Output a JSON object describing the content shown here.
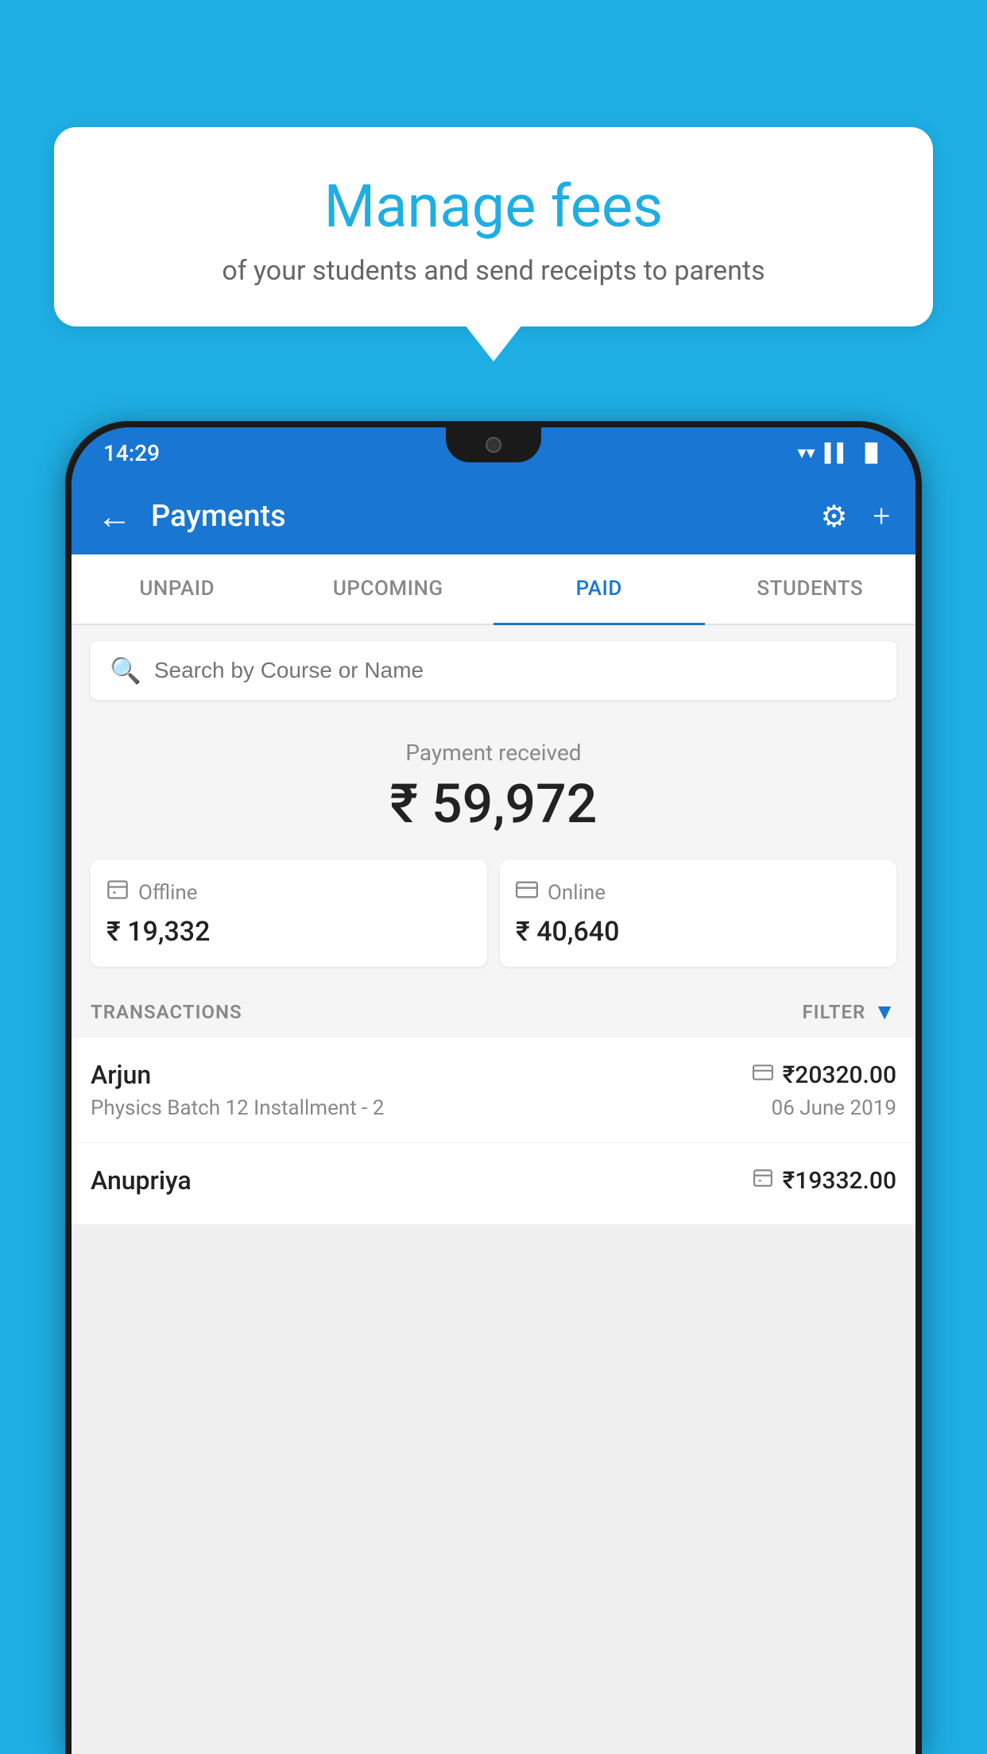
{
  "page": {
    "background_color": "#1EAEE4"
  },
  "speech_bubble": {
    "title": "Manage fees",
    "subtitle": "of your students and send receipts to parents"
  },
  "status_bar": {
    "time": "14:29",
    "wifi_icon": "▼",
    "signal_icon": "◀",
    "battery_icon": "▐"
  },
  "app_bar": {
    "back_icon": "←",
    "title": "Payments",
    "settings_icon": "⚙",
    "add_icon": "+"
  },
  "tabs": [
    {
      "id": "unpaid",
      "label": "UNPAID",
      "active": false
    },
    {
      "id": "upcoming",
      "label": "UPCOMING",
      "active": false
    },
    {
      "id": "paid",
      "label": "PAID",
      "active": true
    },
    {
      "id": "students",
      "label": "STUDENTS",
      "active": false
    }
  ],
  "search": {
    "placeholder": "Search by Course or Name"
  },
  "payment_summary": {
    "label": "Payment received",
    "amount": "₹ 59,972"
  },
  "payment_cards": [
    {
      "id": "offline",
      "icon": "💳",
      "label": "Offline",
      "amount": "₹ 19,332"
    },
    {
      "id": "online",
      "icon": "💳",
      "label": "Online",
      "amount": "₹ 40,640"
    }
  ],
  "transactions": {
    "header_label": "TRANSACTIONS",
    "filter_label": "FILTER"
  },
  "transaction_list": [
    {
      "student_name": "Arjun",
      "payment_type": "online",
      "amount": "₹20320.00",
      "course": "Physics Batch 12 Installment - 2",
      "date": "06 June 2019"
    },
    {
      "student_name": "Anupriya",
      "payment_type": "offline",
      "amount": "₹19332.00",
      "course": "",
      "date": ""
    }
  ]
}
